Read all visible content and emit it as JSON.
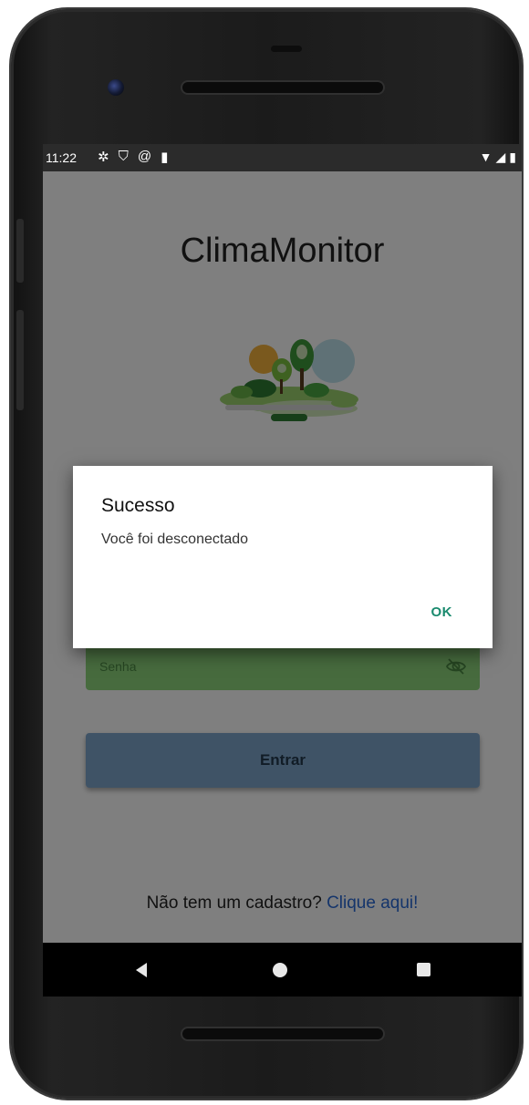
{
  "status_bar": {
    "time": "11:22",
    "left_icons": [
      "gear-icon",
      "shield-icon",
      "at-sign-icon",
      "sd-card-icon"
    ],
    "right_icons": [
      "wifi-icon",
      "signal-icon",
      "battery-icon"
    ]
  },
  "app": {
    "title": "ClimaMonitor",
    "illustration": "park-landscape-illustration",
    "password_field": {
      "placeholder": "Senha"
    },
    "login_button": "Entrar",
    "signup_prompt": "Não tem um cadastro?",
    "signup_link": "Clique aqui!"
  },
  "dialog": {
    "title": "Sucesso",
    "message": "Você foi desconectado",
    "ok_label": "OK"
  },
  "nav_bar": {
    "buttons": [
      "back-icon",
      "home-icon",
      "recents-icon"
    ]
  },
  "colors": {
    "field_green": "#8fd77d",
    "button_blue": "#7fa7cc",
    "link_blue": "#2b6bd6",
    "dialog_accent": "#1a8a6e"
  }
}
